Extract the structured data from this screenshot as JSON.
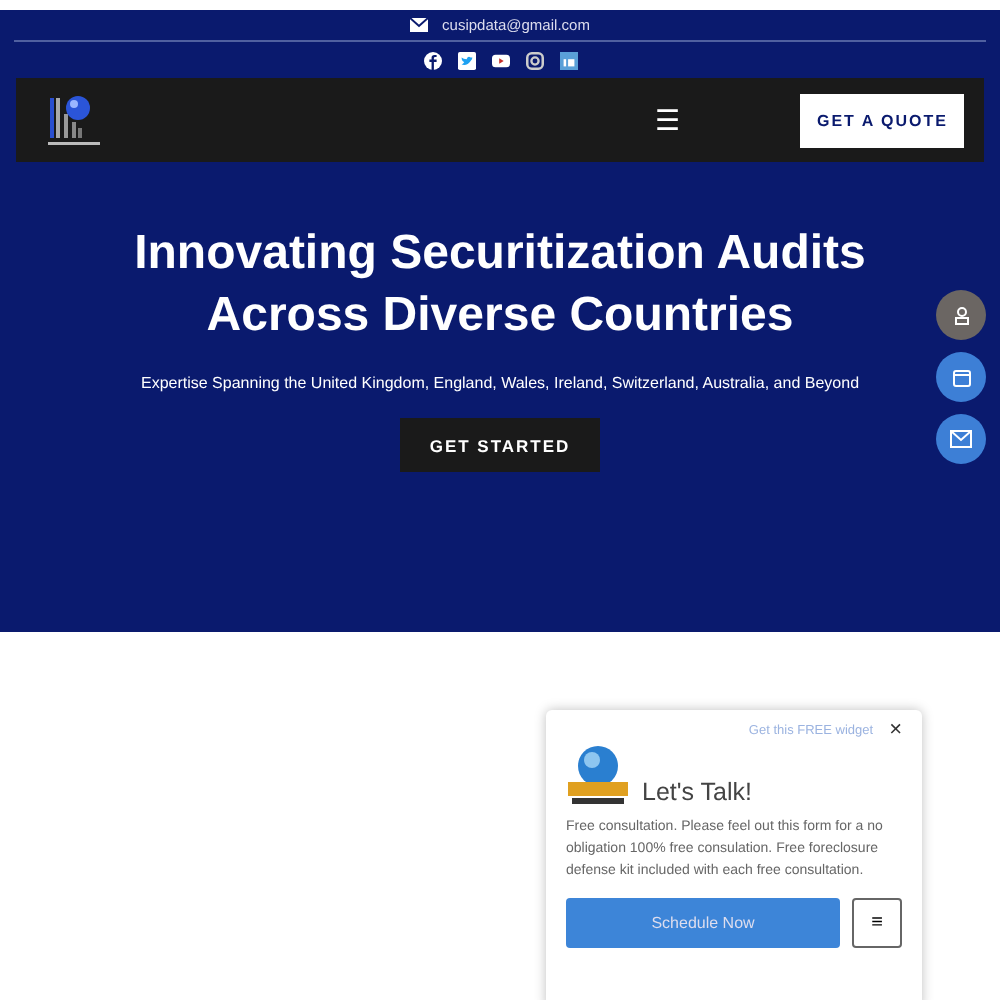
{
  "topbar": {
    "email": "cusipdata@gmail.com",
    "socials": [
      {
        "kind": "facebook"
      },
      {
        "kind": "twitter"
      },
      {
        "kind": "youtube"
      },
      {
        "kind": "instagram"
      },
      {
        "kind": "linkedin"
      }
    ]
  },
  "nav": {
    "menu_icon": "☰",
    "cta": "GET A QUOTE"
  },
  "hero": {
    "title": "Innovating Securitization Audits Across Diverse Countries",
    "subtitle": "Expertise Spanning the United Kingdom, England, Wales, Ireland, Switzerland, Australia, and Beyond",
    "button": "GET STARTED"
  },
  "side_buttons": [
    {
      "kind": "person",
      "color": "#6b6663"
    },
    {
      "kind": "calendar",
      "color": "#3d7fd6"
    },
    {
      "kind": "mail",
      "color": "#3d7fd6"
    }
  ],
  "widget": {
    "promo_link": "Get this FREE widget",
    "close": "×",
    "heading": "Let's Talk!",
    "body": "Free consultation. Please feel out this form for a no obligation 100% free consulation. Free foreclosure defense kit included with each free consultation.",
    "button": "Schedule Now",
    "menu": "≡"
  }
}
